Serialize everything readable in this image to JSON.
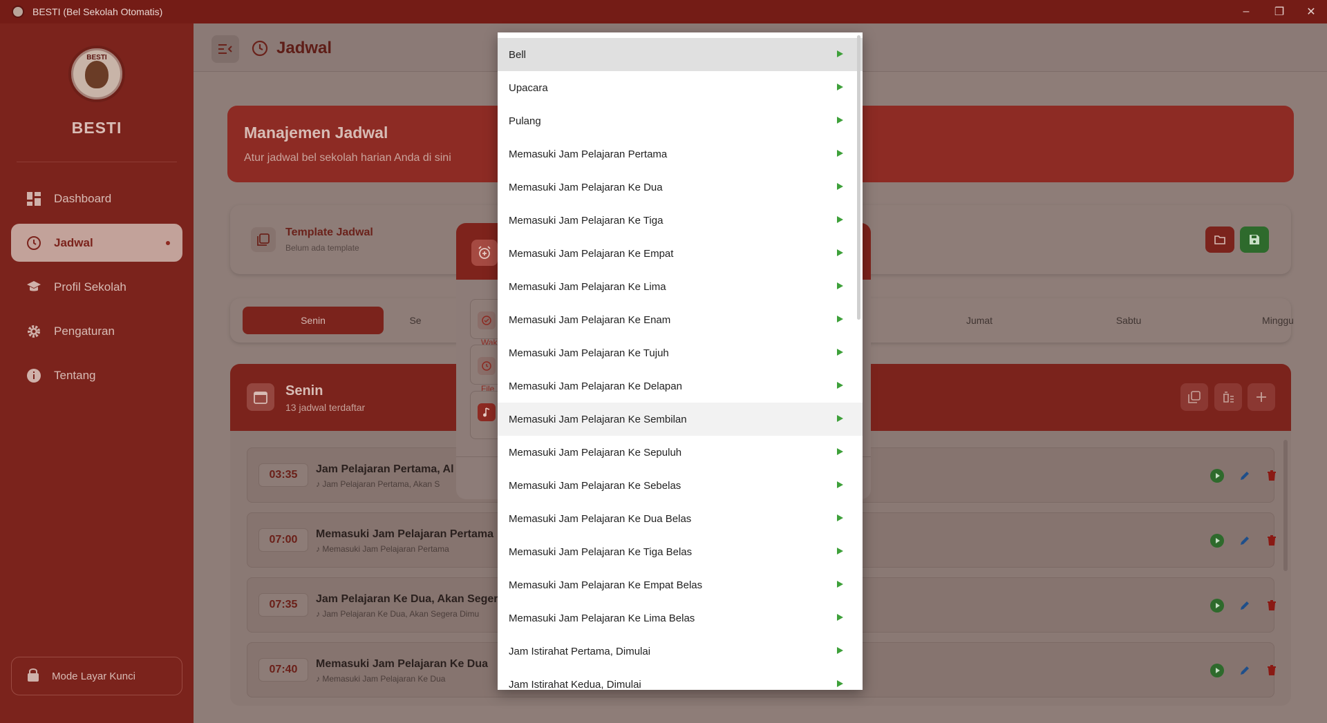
{
  "window": {
    "title": "BESTI (Bel Sekolah Otomatis)",
    "minimize": "–",
    "maximize": "❐",
    "close": "✕"
  },
  "sidebar": {
    "brand": "BESTI",
    "logo_text": "BESTI",
    "items": [
      {
        "label": "Dashboard",
        "icon": "dashboard-icon"
      },
      {
        "label": "Jadwal",
        "icon": "clock-icon",
        "active": true
      },
      {
        "label": "Profil Sekolah",
        "icon": "school-icon"
      },
      {
        "label": "Pengaturan",
        "icon": "gear-icon"
      },
      {
        "label": "Tentang",
        "icon": "info-icon"
      }
    ],
    "lock_label": "Mode Layar Kunci"
  },
  "header": {
    "title": "Jadwal"
  },
  "hero": {
    "title": "Manajemen Jadwal",
    "subtitle": "Atur jadwal bel sekolah harian Anda di sini"
  },
  "template": {
    "title": "Template Jadwal",
    "subtitle": "Belum ada template"
  },
  "days": {
    "items": [
      "Senin",
      "Se",
      "Jumat",
      "Sabtu",
      "Minggu"
    ],
    "selected": "Senin"
  },
  "schedule": {
    "day": "Senin",
    "count_label": "13 jadwal terdaftar",
    "rows": [
      {
        "time": "03:35",
        "title": "Jam Pelajaran Pertama, Al",
        "sound": "Jam Pelajaran Pertama, Akan S"
      },
      {
        "time": "07:00",
        "title": "Memasuki Jam Pelajaran Pertama",
        "sound": "Memasuki Jam Pelajaran Pertama"
      },
      {
        "time": "07:35",
        "title": "Jam Pelajaran Ke Dua, Akan Seger",
        "sound": "Jam Pelajaran Ke Dua, Akan Segera Dimu"
      },
      {
        "time": "07:40",
        "title": "Memasuki Jam Pelajaran Ke Dua",
        "sound": "Memasuki Jam Pelajaran Ke Dua"
      }
    ]
  },
  "dialog": {
    "waktu_label": "Wak",
    "file_label": "File"
  },
  "dropdown": {
    "selected_index": 0,
    "hover_index": 11,
    "options": [
      "Bell",
      "Upacara",
      "Pulang",
      "Memasuki Jam Pelajaran Pertama",
      "Memasuki Jam Pelajaran Ke Dua",
      "Memasuki Jam Pelajaran Ke Tiga",
      "Memasuki Jam Pelajaran Ke Empat",
      "Memasuki Jam Pelajaran Ke Lima",
      "Memasuki Jam Pelajaran Ke Enam",
      "Memasuki Jam Pelajaran Ke Tujuh",
      "Memasuki Jam Pelajaran Ke Delapan",
      "Memasuki Jam Pelajaran Ke Sembilan",
      "Memasuki Jam Pelajaran Ke Sepuluh",
      "Memasuki Jam Pelajaran Ke Sebelas",
      "Memasuki Jam Pelajaran Ke Dua Belas",
      "Memasuki Jam Pelajaran Ke Tiga Belas",
      "Memasuki Jam Pelajaran Ke Empat Belas",
      "Memasuki Jam Pelajaran Ke Lima Belas",
      "Jam Istirahat Pertama, Dimulai",
      "Jam Istirahat Kedua, Dimulai"
    ]
  },
  "colors": {
    "primary": "#C62828",
    "play_green": "#3EA03A",
    "save_green": "#2E7D32"
  }
}
